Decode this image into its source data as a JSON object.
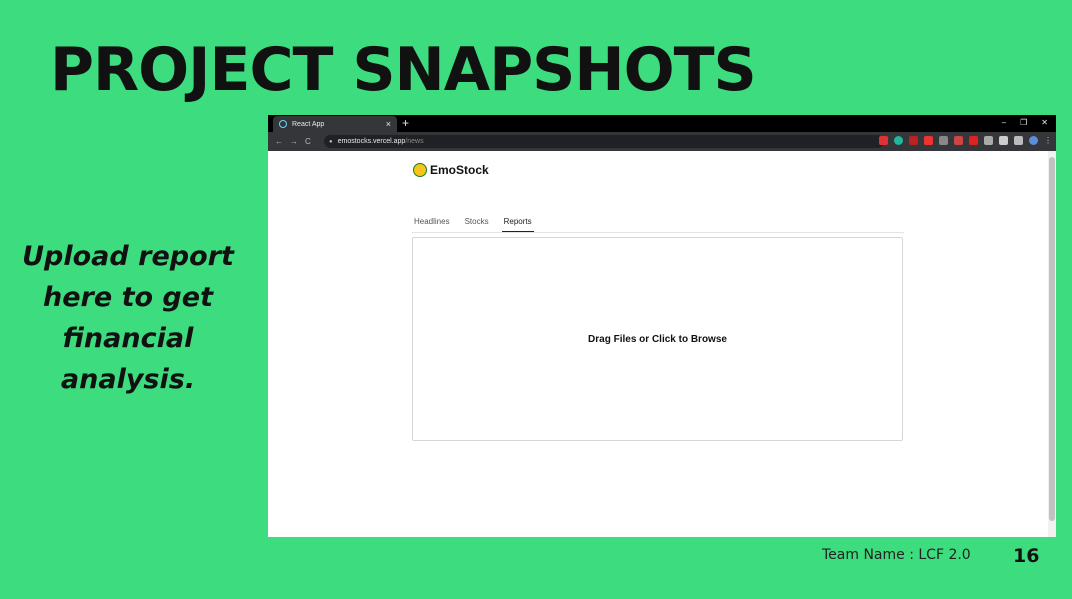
{
  "slide": {
    "title": "PROJECT SNAPSHOTS",
    "caption": "Upload report here to get financial analysis.",
    "team": "Team Name : LCF 2.0",
    "page_number": "16",
    "background_color": "#3ddc7f"
  },
  "browser": {
    "tab_title": "React App",
    "tab_close": "×",
    "new_tab": "+",
    "url_host": "emostocks.vercel.app",
    "url_path": "/news",
    "window_controls": [
      "–",
      "❐",
      "✕"
    ],
    "nav_buttons": [
      "←",
      "→",
      "C"
    ]
  },
  "app": {
    "brand_name": "EmoStock",
    "tabs": [
      "Headlines",
      "Stocks",
      "Reports"
    ],
    "active_tab": "Reports",
    "dropzone_text": "Drag Files or Click to Browse"
  }
}
